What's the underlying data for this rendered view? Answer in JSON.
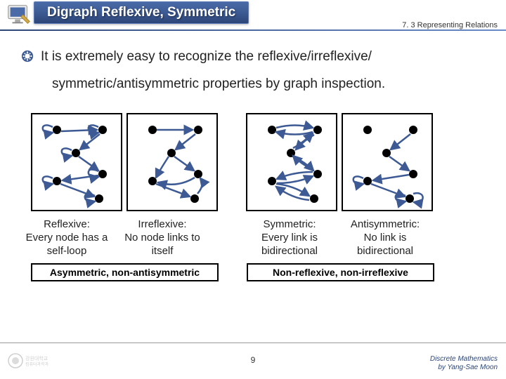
{
  "header": {
    "title": "Digraph Reflexive, Symmetric",
    "section": "7. 3 Representing Relations"
  },
  "bullet": {
    "line1": "It is extremely easy to recognize the reflexive/irreflexive/",
    "line2": "symmetric/antisymmetric properties by graph inspection."
  },
  "captions": {
    "reflexive_title": "Reflexive:",
    "reflexive_body": "Every node has a self-loop",
    "irreflexive_title": "Irreflexive:",
    "irreflexive_body": "No node links to itself",
    "symmetric_title": "Symmetric:",
    "symmetric_body": "Every link is bidirectional",
    "antisymmetric_title": "Antisymmetric:",
    "antisymmetric_body": "No link is bidirectional"
  },
  "subcaps": {
    "left": "Asymmetric, non-antisymmetric",
    "right": "Non-reflexive, non-irreflexive"
  },
  "footer": {
    "page": "9",
    "credit1": "Discrete Mathematics",
    "credit2": "by Yang-Sae Moon"
  }
}
